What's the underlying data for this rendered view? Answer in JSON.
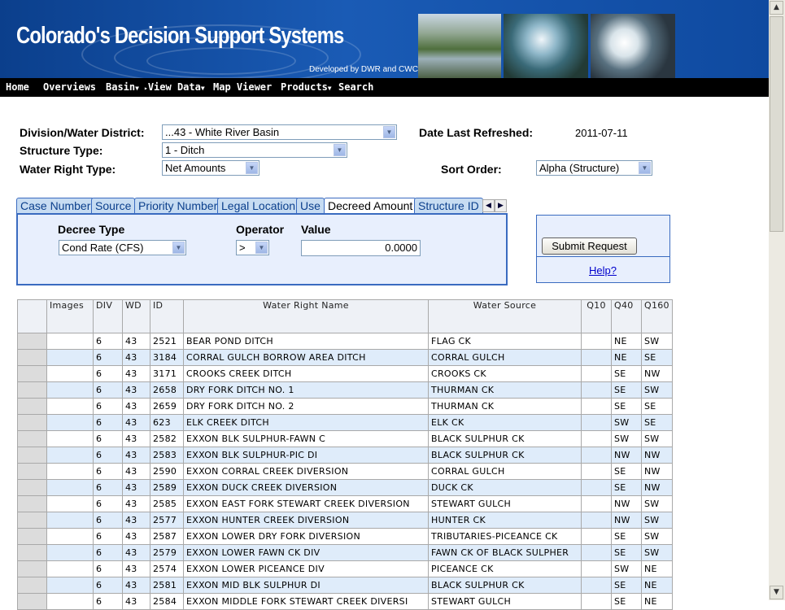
{
  "header": {
    "title": "Colorado's Decision Support Systems",
    "subtitle": "Developed by DWR and CWCB"
  },
  "nav": {
    "home": "Home",
    "overviews": "Overviews",
    "basin": "Basin",
    "view_data": "View Data",
    "map_viewer": "Map Viewer",
    "products": "Products",
    "search": "Search"
  },
  "form": {
    "division_label": "Division/Water District:",
    "division_value": "...43 - White River Basin",
    "structure_type_label": "Structure Type:",
    "structure_type_value": "1 - Ditch",
    "water_right_type_label": "Water Right Type:",
    "water_right_type_value": "Net Amounts",
    "date_refreshed_label": "Date Last Refreshed:",
    "date_refreshed_value": "2011-07-11",
    "sort_order_label": "Sort Order:",
    "sort_order_value": "Alpha (Structure)"
  },
  "tabs": [
    "Case Number",
    "Source",
    "Priority Number",
    "Legal Location",
    "Use",
    "Decreed Amount",
    "Structure ID"
  ],
  "active_tab": "Decreed Amount",
  "filter": {
    "decree_type_label": "Decree Type",
    "decree_type_value": "Cond Rate (CFS)",
    "operator_label": "Operator",
    "operator_value": ">",
    "value_label": "Value",
    "value_value": "0.0000"
  },
  "actions": {
    "submit_label": "Submit Request",
    "help_label": "Help?"
  },
  "table": {
    "columns": [
      "",
      "Images",
      "DIV",
      "WD",
      "ID",
      "Water Right Name",
      "Water Source",
      "Q10",
      "Q40",
      "Q160"
    ],
    "rows": [
      [
        "6",
        "43",
        "2521",
        "BEAR POND DITCH",
        "FLAG CK",
        "",
        "NE",
        "SW"
      ],
      [
        "6",
        "43",
        "3184",
        "CORRAL GULCH BORROW AREA DITCH",
        "CORRAL GULCH",
        "",
        "NE",
        "SE"
      ],
      [
        "6",
        "43",
        "3171",
        "CROOKS CREEK DITCH",
        "CROOKS CK",
        "",
        "SE",
        "NW"
      ],
      [
        "6",
        "43",
        "2658",
        "DRY FORK DITCH NO. 1",
        "THURMAN CK",
        "",
        "SE",
        "SW"
      ],
      [
        "6",
        "43",
        "2659",
        "DRY FORK DITCH NO. 2",
        "THURMAN CK",
        "",
        "SE",
        "SE"
      ],
      [
        "6",
        "43",
        "623",
        "ELK CREEK DITCH",
        "ELK CK",
        "",
        "SW",
        "SE"
      ],
      [
        "6",
        "43",
        "2582",
        "EXXON BLK SULPHUR-FAWN C",
        "BLACK SULPHUR CK",
        "",
        "SW",
        "SW"
      ],
      [
        "6",
        "43",
        "2583",
        "EXXON BLK SULPHUR-PIC DI",
        "BLACK SULPHUR CK",
        "",
        "NW",
        "NW"
      ],
      [
        "6",
        "43",
        "2590",
        "EXXON CORRAL CREEK DIVERSION",
        "CORRAL GULCH",
        "",
        "SE",
        "NW"
      ],
      [
        "6",
        "43",
        "2589",
        "EXXON DUCK CREEK DIVERSION",
        "DUCK CK",
        "",
        "SE",
        "NW"
      ],
      [
        "6",
        "43",
        "2585",
        "EXXON EAST FORK STEWART CREEK DIVERSION",
        "STEWART GULCH",
        "",
        "NW",
        "SW"
      ],
      [
        "6",
        "43",
        "2577",
        "EXXON HUNTER CREEK DIVERSION",
        "HUNTER CK",
        "",
        "NW",
        "SW"
      ],
      [
        "6",
        "43",
        "2587",
        "EXXON LOWER DRY FORK DIVERSION",
        "TRIBUTARIES-PICEANCE CK",
        "",
        "SE",
        "SW"
      ],
      [
        "6",
        "43",
        "2579",
        "EXXON LOWER FAWN CK DIV",
        "FAWN CK OF BLACK SULPHER",
        "",
        "SE",
        "SW"
      ],
      [
        "6",
        "43",
        "2574",
        "EXXON LOWER PICEANCE DIV",
        "PICEANCE CK",
        "",
        "SW",
        "NE"
      ],
      [
        "6",
        "43",
        "2581",
        "EXXON MID BLK SULPHUR DI",
        "BLACK SULPHUR CK",
        "",
        "SE",
        "NE"
      ],
      [
        "6",
        "43",
        "2584",
        "EXXON MIDDLE FORK STEWART CREEK DIVERSI",
        "STEWART GULCH",
        "",
        "SE",
        "NE"
      ]
    ]
  }
}
